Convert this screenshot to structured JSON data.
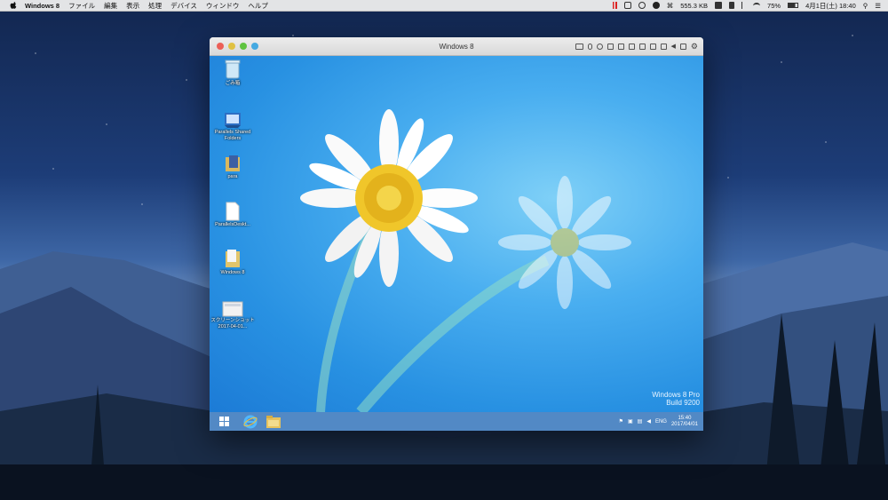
{
  "menubar": {
    "items": [
      "Windows 8",
      "ファイル",
      "編集",
      "表示",
      "処理",
      "デバイス",
      "ウィンドウ",
      "ヘルプ"
    ],
    "network_speed": "555.3 KB",
    "battery": "75%",
    "datetime": "4月1日(土) 18:40"
  },
  "window": {
    "title": "Windows 8"
  },
  "guest": {
    "desktop_icons": [
      {
        "name": "recycle-bin",
        "label": "ごみ箱"
      },
      {
        "name": "parallels-shared-folders",
        "label": "Parallels Shared Folders"
      },
      {
        "name": "para",
        "label": "para"
      },
      {
        "name": "parallels-desktop-file",
        "label": "ParallelsDeskt..."
      },
      {
        "name": "windows-8-folder",
        "label": "Windows 8"
      },
      {
        "name": "screenshot-file",
        "label": "スクリーンショット 2017-04-01..."
      }
    ],
    "watermark": {
      "line1": "Windows 8 Pro",
      "line2": "Build 9200"
    },
    "taskbar": {
      "language": "ENG",
      "time": "15:40",
      "date": "2017/04/01"
    }
  },
  "colors": {
    "guest_wallpaper": "#49aef0",
    "taskbar": "#3778be",
    "menubar": "#ececec"
  }
}
